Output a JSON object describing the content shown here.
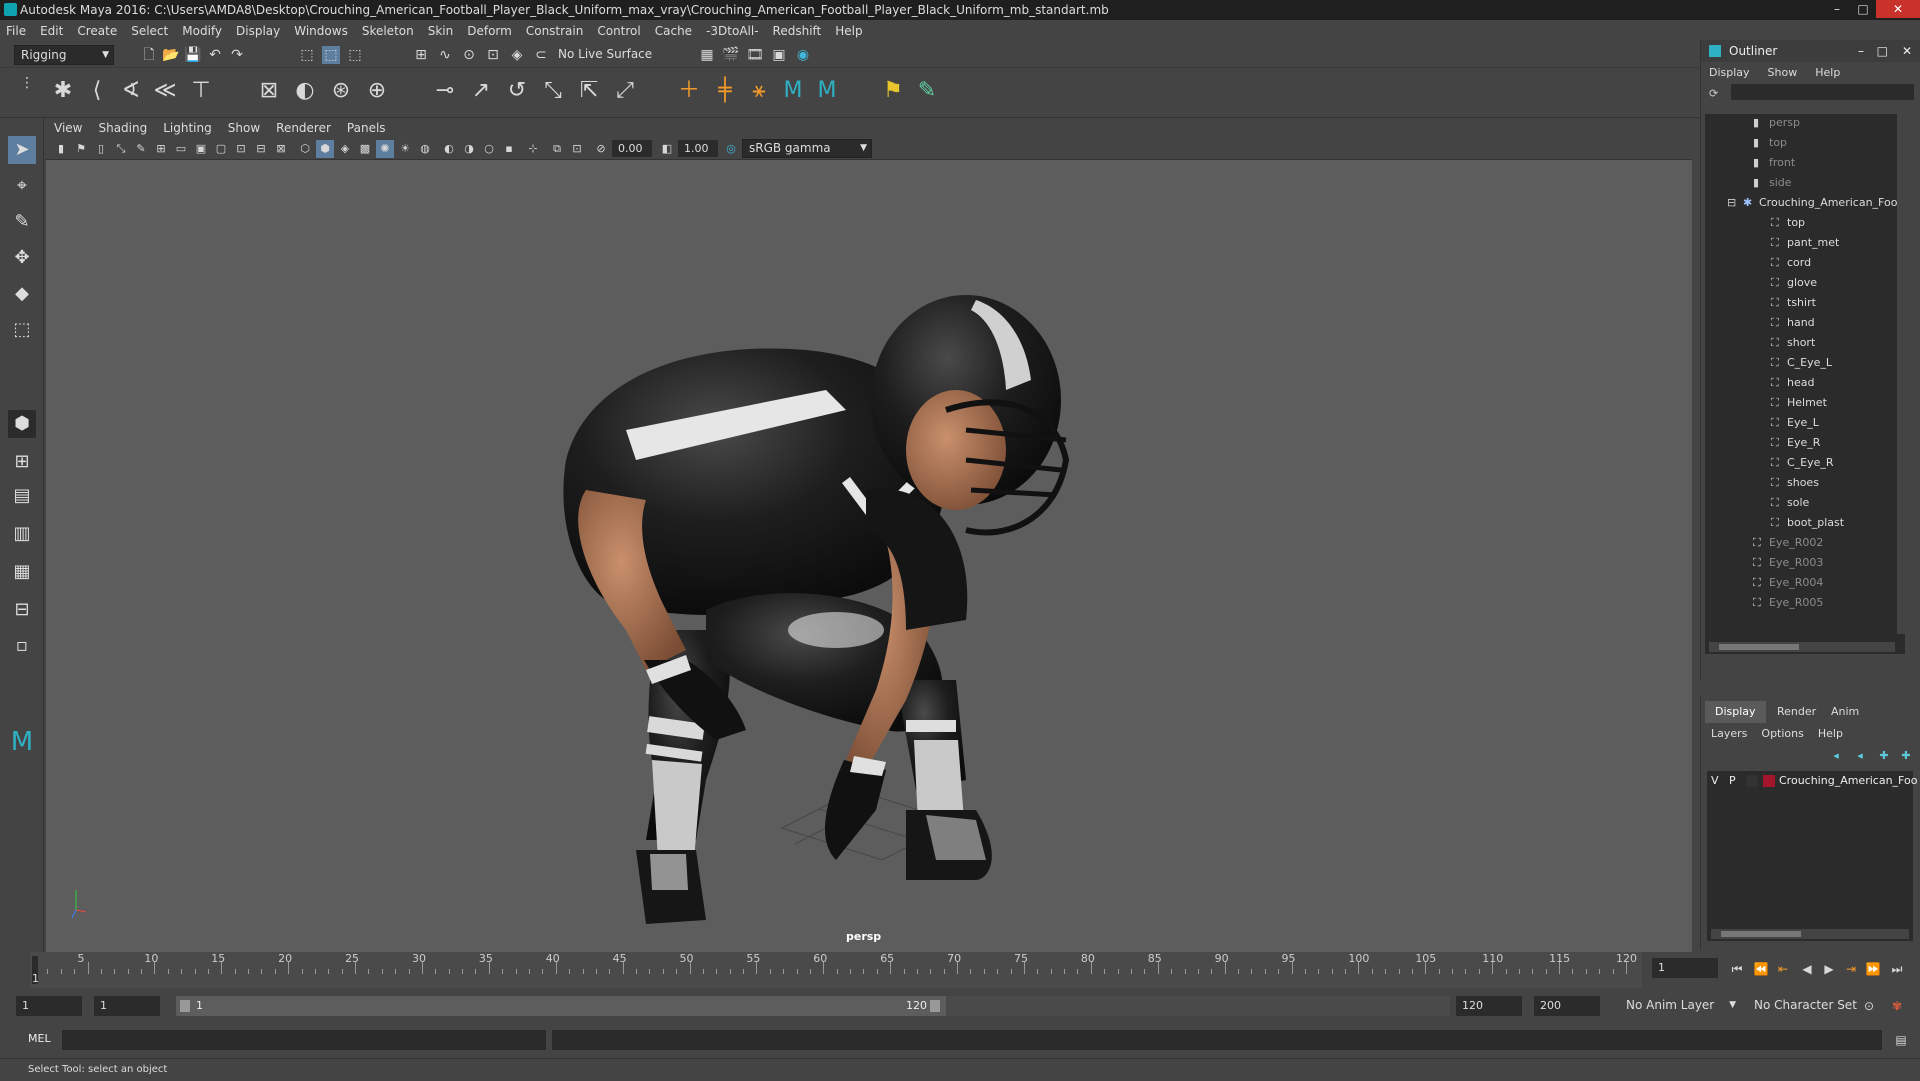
{
  "window": {
    "title": "Autodesk Maya 2016: C:\\Users\\AMDA8\\Desktop\\Crouching_American_Football_Player_Black_Uniform_max_vray\\Crouching_American_Football_Player_Black_Uniform_mb_standart.mb",
    "minimize": "–",
    "maximize": "□",
    "close": "✕"
  },
  "menubar": [
    "File",
    "Edit",
    "Create",
    "Select",
    "Modify",
    "Display",
    "Windows",
    "Skeleton",
    "Skin",
    "Deform",
    "Constrain",
    "Control",
    "Cache",
    "-3DtoAll-",
    "Redshift",
    "Help"
  ],
  "statusline": {
    "mode": "Rigging",
    "live_surface": "No Live Surface"
  },
  "viewport": {
    "menu": [
      "View",
      "Shading",
      "Lighting",
      "Show",
      "Renderer",
      "Panels"
    ],
    "exposure": "0.00",
    "gamma": "1.00",
    "color_space": "sRGB gamma",
    "camera": "persp"
  },
  "outliner": {
    "title": "Outliner",
    "menu": [
      "Display",
      "Show",
      "Help"
    ],
    "items": [
      {
        "label": "persp",
        "dim": true,
        "indent": 0
      },
      {
        "label": "top",
        "dim": true,
        "indent": 0
      },
      {
        "label": "front",
        "dim": true,
        "indent": 0
      },
      {
        "label": "side",
        "dim": true,
        "indent": 0
      },
      {
        "label": "Crouching_American_Foo",
        "dim": false,
        "indent": 0
      },
      {
        "label": "top",
        "dim": false,
        "indent": 1
      },
      {
        "label": "pant_met",
        "dim": false,
        "indent": 1
      },
      {
        "label": "cord",
        "dim": false,
        "indent": 1
      },
      {
        "label": "glove",
        "dim": false,
        "indent": 1
      },
      {
        "label": "tshirt",
        "dim": false,
        "indent": 1
      },
      {
        "label": "hand",
        "dim": false,
        "indent": 1
      },
      {
        "label": "short",
        "dim": false,
        "indent": 1
      },
      {
        "label": "C_Eye_L",
        "dim": false,
        "indent": 1
      },
      {
        "label": "head",
        "dim": false,
        "indent": 1
      },
      {
        "label": "Helmet",
        "dim": false,
        "indent": 1
      },
      {
        "label": "Eye_L",
        "dim": false,
        "indent": 1
      },
      {
        "label": "Eye_R",
        "dim": false,
        "indent": 1
      },
      {
        "label": "C_Eye_R",
        "dim": false,
        "indent": 1
      },
      {
        "label": "shoes",
        "dim": false,
        "indent": 1
      },
      {
        "label": "sole",
        "dim": false,
        "indent": 1
      },
      {
        "label": "boot_plast",
        "dim": false,
        "indent": 1
      },
      {
        "label": "Eye_R002",
        "dim": true,
        "indent": 0
      },
      {
        "label": "Eye_R003",
        "dim": true,
        "indent": 0
      },
      {
        "label": "Eye_R004",
        "dim": true,
        "indent": 0
      },
      {
        "label": "Eye_R005",
        "dim": true,
        "indent": 0
      }
    ]
  },
  "layers": {
    "tabs": [
      "Display",
      "Render",
      "Anim"
    ],
    "menu": [
      "Layers",
      "Options",
      "Help"
    ],
    "row": {
      "v": "V",
      "p": "P",
      "name": "Crouching_American_Foo",
      "color": "#a3152a"
    }
  },
  "timeline": {
    "ticks": [
      "5",
      "10",
      "15",
      "20",
      "25",
      "30",
      "35",
      "40",
      "45",
      "50",
      "55",
      "60",
      "65",
      "70",
      "75",
      "80",
      "85",
      "90",
      "95",
      "100",
      "105",
      "110",
      "115",
      "120"
    ],
    "current_frame": "1",
    "start_field": "1",
    "current_field": "1",
    "range_start": "1",
    "range_end": "120",
    "end_field": "120",
    "max_field": "200",
    "anim_layer": "No Anim Layer",
    "character_set": "No Character Set"
  },
  "cmdline": {
    "label": "MEL"
  },
  "helpline": {
    "text": "Select Tool: select an object"
  }
}
